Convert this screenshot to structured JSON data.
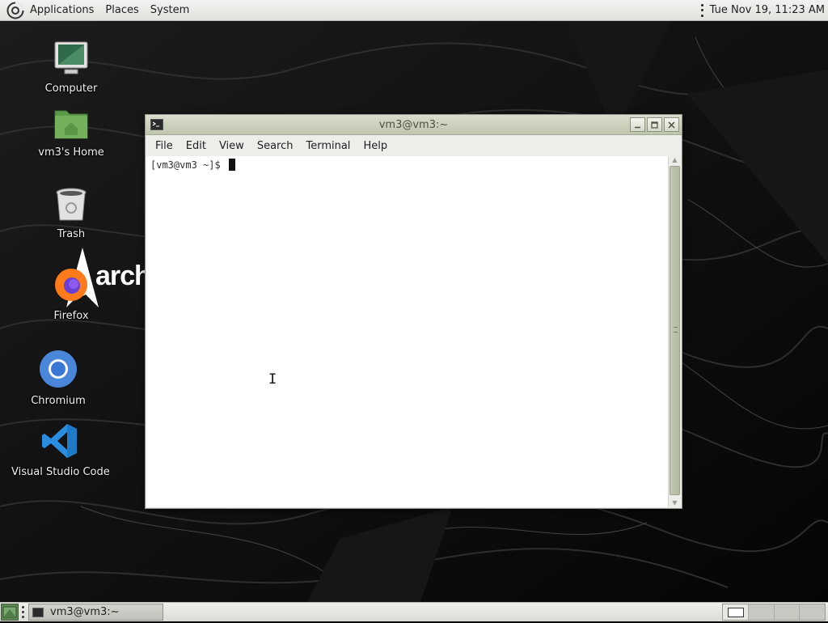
{
  "top_panel": {
    "menus": [
      "Applications",
      "Places",
      "System"
    ],
    "clock": "Tue Nov 19, 11:23 AM"
  },
  "desktop": {
    "icons": [
      {
        "label": "Computer",
        "icon": "computer-icon"
      },
      {
        "label": "vm3's Home",
        "icon": "home-folder-icon"
      },
      {
        "label": "Trash",
        "icon": "trash-icon"
      },
      {
        "label": "Firefox",
        "icon": "firefox-icon"
      },
      {
        "label": "Chromium",
        "icon": "chromium-icon"
      },
      {
        "label": "Visual Studio Code",
        "icon": "vscode-icon"
      }
    ],
    "wallpaper_logo_text": "arch"
  },
  "terminal": {
    "title": "vm3@vm3:~",
    "menu": [
      "File",
      "Edit",
      "View",
      "Search",
      "Terminal",
      "Help"
    ],
    "prompt": "[vm3@vm3 ~]$ ",
    "window_buttons": [
      "minimize-button",
      "maximize-button",
      "close-button"
    ]
  },
  "bottom_panel": {
    "task_label": "vm3@vm3:~",
    "workspace_count": 4,
    "active_workspace": 1
  },
  "colors": {
    "panel_bg": "#e6e6e2",
    "titlebar": "#c9cfb9",
    "terminal_bg": "#ffffff",
    "desktop_bg": "#070707"
  }
}
